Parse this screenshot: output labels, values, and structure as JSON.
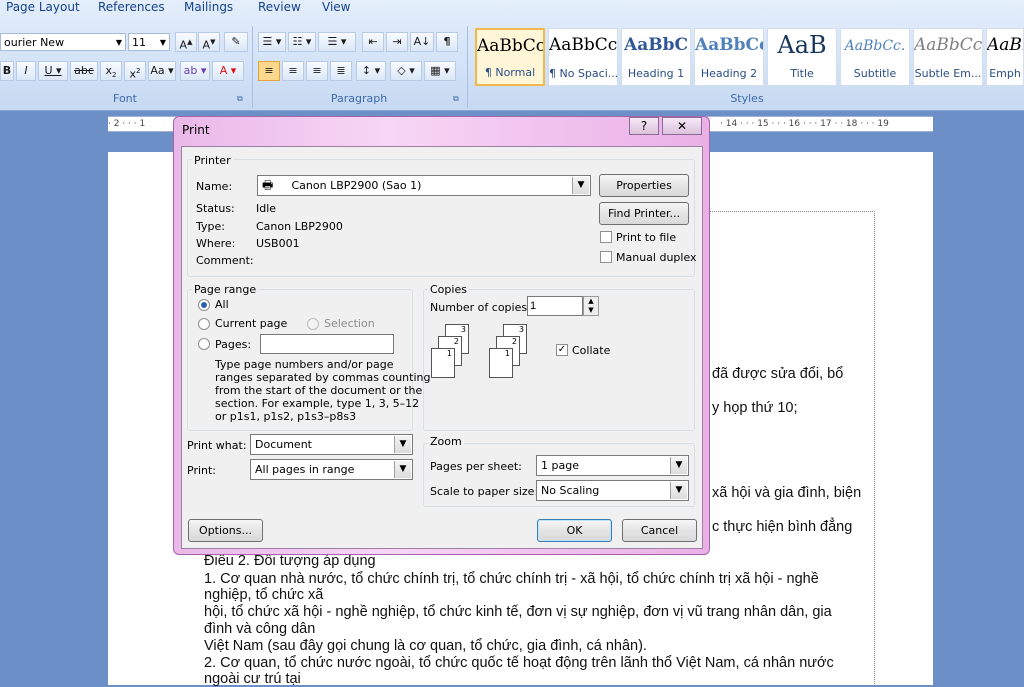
{
  "ribbon": {
    "tabs": [
      "Page Layout",
      "References",
      "Mailings",
      "Review",
      "View"
    ],
    "font_name": "ourier New",
    "font_size": "11",
    "font_group_label": "Font",
    "paragraph_group_label": "Paragraph",
    "styles_group_label": "Styles",
    "styles": [
      {
        "sample": "AaBbCc",
        "name": "¶ Normal"
      },
      {
        "sample": "AaBbCc",
        "name": "¶ No Spaci..."
      },
      {
        "sample": "AaBbC",
        "name": "Heading 1"
      },
      {
        "sample": "AaBbCc",
        "name": "Heading 2"
      },
      {
        "sample": "AaB",
        "name": "Title"
      },
      {
        "sample": "AaBbCc.",
        "name": "Subtitle"
      },
      {
        "sample": "AaBbCc",
        "name": "Subtle Em..."
      },
      {
        "sample": "AaBb",
        "name": "Emph"
      }
    ]
  },
  "ruler": {
    "left_text": "· 2 · · · 1",
    "right_text": "· 14 · · · 15 · · · 16 · · · 17 · · 18 · · · 19"
  },
  "document": {
    "lines_right": [
      "đã được sửa đổi, bổ",
      "y họp thứ 10;",
      "xã hội và gia đình, biện",
      "c thực hiện bình đẳng"
    ],
    "lines_bottom": [
      "Điều 2. Đối tượng áp dụng",
      "1. Cơ quan nhà nước, tổ chức chính trị, tổ chức chính trị - xã hội, tổ chức chính trị xã hội - nghề",
      "nghiệp, tổ chức xã",
      "hội, tổ chức xã hội - nghề nghiệp, tổ chức kinh tế, đơn vị sự nghiệp, đơn vị vũ trang nhân dân, gia",
      "đình và công dân",
      "Việt Nam (sau đây gọi chung là cơ quan, tổ chức, gia đình, cá nhân).",
      "2. Cơ quan, tổ chức nước ngoài, tổ chức quốc tế hoạt động trên lãnh thổ Việt Nam, cá nhân nước",
      "ngoài cư trú tại"
    ]
  },
  "dialog": {
    "title": "Print",
    "help_glyph": "?",
    "close_glyph": "✕",
    "printer": {
      "legend": "Printer",
      "name_label": "Name:",
      "name_value": "Canon LBP2900 (Sao 1)",
      "status_label": "Status:",
      "status_value": "Idle",
      "type_label": "Type:",
      "type_value": "Canon LBP2900",
      "where_label": "Where:",
      "where_value": "USB001",
      "comment_label": "Comment:",
      "comment_value": "",
      "properties_button": "Properties",
      "find_printer_button": "Find Printer...",
      "print_to_file_label": "Print to file",
      "print_to_file_checked": false,
      "manual_duplex_label": "Manual duplex",
      "manual_duplex_checked": false
    },
    "page_range": {
      "legend": "Page range",
      "all_label": "All",
      "current_page_label": "Current page",
      "selection_label": "Selection",
      "pages_label": "Pages:",
      "pages_value": "",
      "selected": "all",
      "help_lines": [
        "Type page numbers and/or page",
        "ranges separated by commas counting",
        "from the start of the document or the",
        "section. For example, type 1, 3, 5–12",
        "or p1s1, p1s2, p1s3–p8s3"
      ]
    },
    "copies": {
      "legend": "Copies",
      "number_label": "Number of copies:",
      "number_value": "1",
      "collate_label": "Collate",
      "collate_checked": true,
      "stack_numbers": [
        "3",
        "2",
        "1"
      ]
    },
    "print_what_label": "Print what:",
    "print_what_value": "Document",
    "print_label": "Print:",
    "print_value": "All pages in range",
    "zoom": {
      "legend": "Zoom",
      "pages_per_sheet_label": "Pages per sheet:",
      "pages_per_sheet_value": "1 page",
      "scale_label": "Scale to paper size:",
      "scale_value": "No Scaling"
    },
    "options_button": "Options...",
    "ok_button": "OK",
    "cancel_button": "Cancel"
  }
}
